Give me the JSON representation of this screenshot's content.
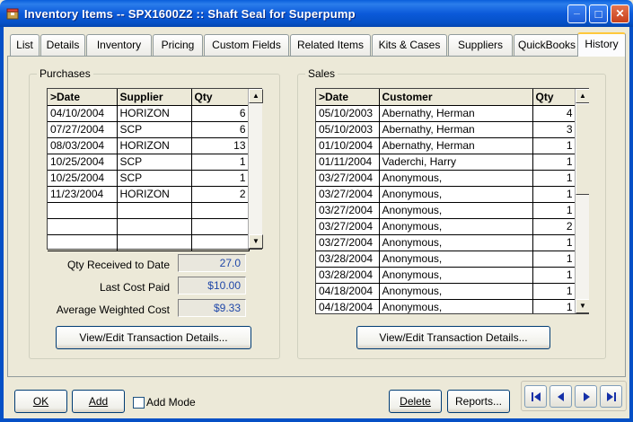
{
  "window": {
    "title": "Inventory Items -- SPX1600Z2 :: Shaft Seal for Superpump",
    "minimize": "_",
    "maximize": "□",
    "close": "✕"
  },
  "tabs": [
    {
      "label": "List"
    },
    {
      "label": "Details"
    },
    {
      "label": "Inventory"
    },
    {
      "label": "Pricing"
    },
    {
      "label": "Custom Fields"
    },
    {
      "label": "Related Items"
    },
    {
      "label": "Kits & Cases"
    },
    {
      "label": "Suppliers"
    },
    {
      "label": "QuickBooks"
    },
    {
      "label": "History",
      "active": true
    }
  ],
  "purchases": {
    "title": "Purchases",
    "columns": [
      ">Date",
      "Supplier",
      "Qty"
    ],
    "rows": [
      [
        "04/10/2004",
        "HORIZON",
        "6"
      ],
      [
        "07/27/2004",
        "SCP",
        "6"
      ],
      [
        "08/03/2004",
        "HORIZON",
        "13"
      ],
      [
        "10/25/2004",
        "SCP",
        "1"
      ],
      [
        "10/25/2004",
        "SCP",
        "1"
      ],
      [
        "11/23/2004",
        "HORIZON",
        "2"
      ],
      [
        "",
        "",
        ""
      ],
      [
        "",
        "",
        ""
      ],
      [
        "",
        "",
        ""
      ]
    ],
    "stats": [
      {
        "label": "Qty Received to Date",
        "value": "27.0"
      },
      {
        "label": "Last Cost Paid",
        "value": "$10.00"
      },
      {
        "label": "Average Weighted Cost",
        "value": "$9.33"
      }
    ],
    "details_button": "View/Edit Transaction Details..."
  },
  "sales": {
    "title": "Sales",
    "columns": [
      ">Date",
      "Customer",
      "Qty"
    ],
    "rows": [
      [
        "05/10/2003",
        "Abernathy, Herman",
        "4"
      ],
      [
        "05/10/2003",
        "Abernathy, Herman",
        "3"
      ],
      [
        "01/10/2004",
        "Abernathy, Herman",
        "1"
      ],
      [
        "01/11/2004",
        "Vaderchi, Harry",
        "1"
      ],
      [
        "03/27/2004",
        "Anonymous,",
        "1"
      ],
      [
        "03/27/2004",
        "Anonymous,",
        "1"
      ],
      [
        "03/27/2004",
        "Anonymous,",
        "1"
      ],
      [
        "03/27/2004",
        "Anonymous,",
        "2"
      ],
      [
        "03/27/2004",
        "Anonymous,",
        "1"
      ],
      [
        "03/28/2004",
        "Anonymous,",
        "1"
      ],
      [
        "03/28/2004",
        "Anonymous,",
        "1"
      ],
      [
        "04/18/2004",
        "Anonymous,",
        "1"
      ],
      [
        "04/18/2004",
        "Anonymous,",
        "1"
      ]
    ],
    "details_button": "View/Edit Transaction Details..."
  },
  "footer": {
    "ok_label": "OK",
    "add_label": "Add",
    "add_mode_label": "Add Mode",
    "delete_label": "Delete",
    "reports_label": "Reports..."
  },
  "icons": {
    "app": "inventory-box-icon",
    "first": "first-record-icon",
    "prev": "previous-record-icon",
    "next": "next-record-icon",
    "last": "last-record-icon"
  },
  "colors": {
    "titlebar": "#0550C6",
    "readonly_value": "#1F47A8",
    "active_tab_accent": "#FFC83C"
  }
}
